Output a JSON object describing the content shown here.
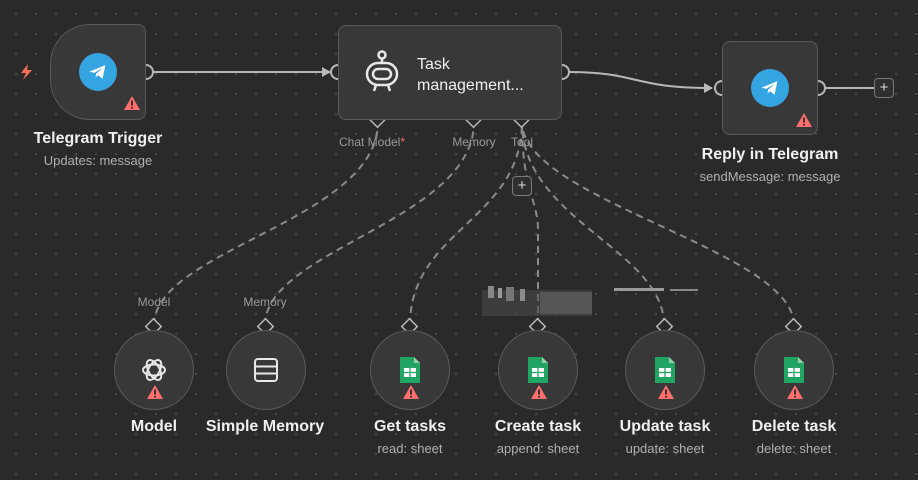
{
  "colors": {
    "canvas": "#2a2a2a",
    "node": "#383838",
    "node_border": "#5a5a5a",
    "telegram": "#35a5e2",
    "sheets": "#21a464",
    "warning": "#ff6d6d",
    "trigger_bolt": "#ff6d5a",
    "edge": "#b8b8b8"
  },
  "trigger_node": {
    "title": "Telegram Trigger",
    "subtitle": "Updates: message",
    "icon": "telegram-icon"
  },
  "agent_node": {
    "name": "Task management...",
    "icon": "robot-icon",
    "handles": {
      "chat_model": "Chat Model",
      "chat_model_required": "*",
      "memory": "Memory",
      "tool": "Tool"
    }
  },
  "reply_node": {
    "title": "Reply in Telegram",
    "subtitle": "sendMessage: message",
    "icon": "telegram-icon"
  },
  "sub_nodes": [
    {
      "title": "Model",
      "subtitle": "",
      "handle_label": "Model",
      "icon": "openai-icon"
    },
    {
      "title": "Simple Memory",
      "subtitle": "",
      "handle_label": "Memory",
      "icon": "database-icon"
    },
    {
      "title": "Get tasks",
      "subtitle": "read: sheet",
      "icon": "google-sheets-icon"
    },
    {
      "title": "Create task",
      "subtitle": "append: sheet",
      "icon": "google-sheets-icon"
    },
    {
      "title": "Update task",
      "subtitle": "update: sheet",
      "icon": "google-sheets-icon"
    },
    {
      "title": "Delete task",
      "subtitle": "delete: sheet",
      "icon": "google-sheets-icon"
    }
  ],
  "buttons": {
    "add": "+"
  }
}
